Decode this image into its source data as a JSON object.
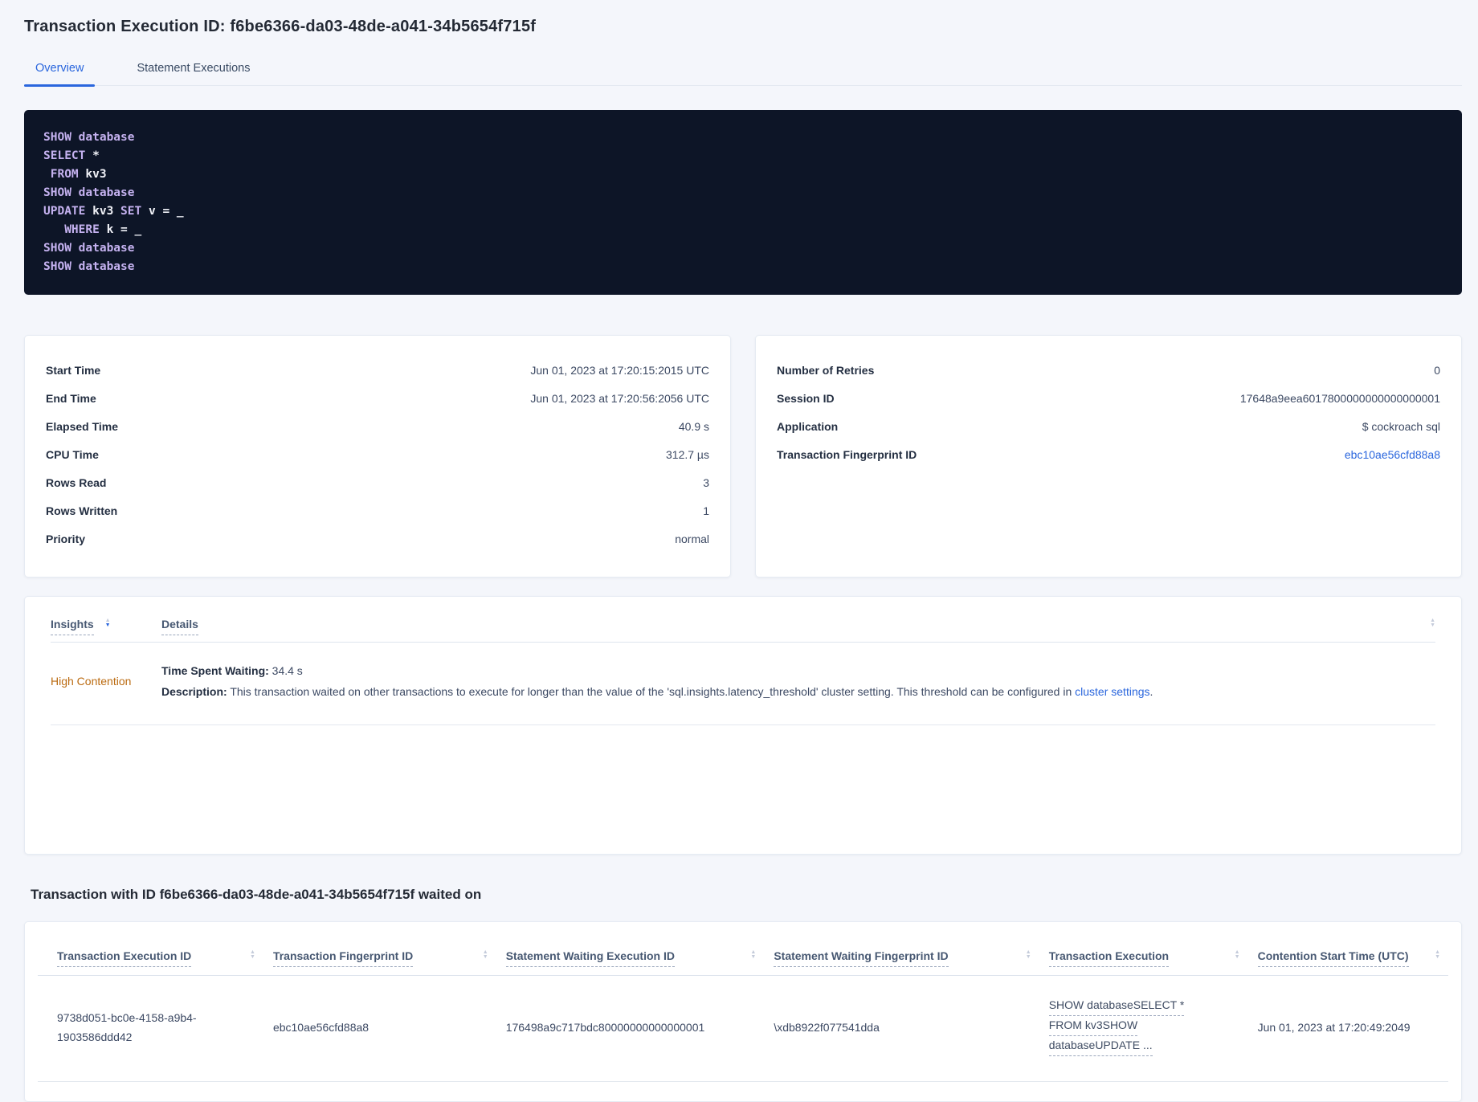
{
  "header": {
    "title": "Transaction Execution ID: f6be6366-da03-48de-a041-34b5654f715f"
  },
  "tabs": {
    "overview": "Overview",
    "statement_executions": "Statement Executions"
  },
  "icons": {
    "sort_up": "▲",
    "sort_down": "▼"
  },
  "colors": {
    "accent_blue": "#2a66dd",
    "insight_orange": "#bb6b11",
    "sql_box_bg": "#0d1527",
    "sql_keyword": "#c5b2f0",
    "sql_plain": "#f0f1f7",
    "page_bg": "#f4f6fb"
  },
  "sql": {
    "lines": [
      {
        "segs": [
          {
            "c": "kw",
            "t": "SHOW database"
          }
        ]
      },
      {
        "segs": [
          {
            "c": "kw",
            "t": "SELECT"
          },
          {
            "c": "pl",
            "t": " *"
          }
        ]
      },
      {
        "segs": [
          {
            "c": "kw",
            "t": " FROM"
          },
          {
            "c": "pl",
            "t": " kv3"
          }
        ]
      },
      {
        "segs": [
          {
            "c": "kw",
            "t": "SHOW database"
          }
        ]
      },
      {
        "segs": [
          {
            "c": "kw",
            "t": "UPDATE"
          },
          {
            "c": "pl",
            "t": " kv3 "
          },
          {
            "c": "kw",
            "t": "SET"
          },
          {
            "c": "pl",
            "t": " v = _"
          }
        ]
      },
      {
        "segs": [
          {
            "c": "kw",
            "t": "   WHERE"
          },
          {
            "c": "pl",
            "t": " k = _"
          }
        ]
      },
      {
        "segs": [
          {
            "c": "kw",
            "t": "SHOW database"
          }
        ]
      },
      {
        "segs": [
          {
            "c": "kw",
            "t": "SHOW database"
          }
        ]
      }
    ]
  },
  "summary_left": {
    "rows": [
      {
        "label": "Start Time",
        "value": "Jun 01, 2023 at 17:20:15:2015 UTC"
      },
      {
        "label": "End Time",
        "value": "Jun 01, 2023 at 17:20:56:2056 UTC"
      },
      {
        "label": "Elapsed Time",
        "value": "40.9 s"
      },
      {
        "label": "CPU Time",
        "value": "312.7 µs"
      },
      {
        "label": "Rows Read",
        "value": "3"
      },
      {
        "label": "Rows Written",
        "value": "1"
      },
      {
        "label": "Priority",
        "value": "normal"
      }
    ]
  },
  "summary_right": {
    "rows": [
      {
        "label": "Number of Retries",
        "value": "0"
      },
      {
        "label": "Session ID",
        "value": "17648a9eea6017800000000000000001"
      },
      {
        "label": "Application",
        "value": "$ cockroach sql"
      }
    ],
    "fingerprint_label": "Transaction Fingerprint ID",
    "fingerprint_value": "ebc10ae56cfd88a8"
  },
  "insights": {
    "col_insights": "Insights",
    "col_details": "Details",
    "row": {
      "insight": "High Contention",
      "waiting_label": "Time Spent Waiting:",
      "waiting_value": " 34.4 s",
      "desc_label": "Description:",
      "desc_text": " This transaction waited on other transactions to execute for longer than the value of the 'sql.insights.latency_threshold' cluster setting. This threshold can be configured in ",
      "desc_link": "cluster settings",
      "desc_end": "."
    }
  },
  "waited_section": {
    "heading": "Transaction with ID f6be6366-da03-48de-a041-34b5654f715f waited on",
    "columns": [
      "Transaction Execution ID",
      "Transaction Fingerprint ID",
      "Statement Waiting Execution ID",
      "Statement Waiting Fingerprint ID",
      "Transaction Execution",
      "Contention Start Time (UTC)"
    ],
    "row": {
      "txn_exec_id": "9738d051-bc0e-4158-a9b4-1903586ddd42",
      "txn_fingerprint": "ebc10ae56cfd88a8",
      "stmt_exec_id": "176498a9c717bdc80000000000000001",
      "stmt_fingerprint": "\\xdb8922f077541dda",
      "txn_exec_lines": [
        "SHOW databaseSELECT *",
        "FROM kv3SHOW",
        "databaseUPDATE ..."
      ],
      "contention_start": "Jun 01, 2023 at 17:20:49:2049"
    }
  }
}
